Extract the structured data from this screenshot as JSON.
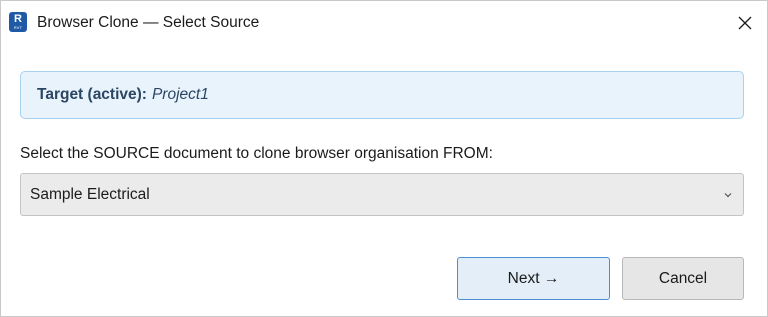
{
  "window": {
    "title": "Browser Clone — Select Source",
    "app_icon": {
      "name": "revit-icon",
      "letter": "R",
      "sub": "RVT",
      "color": "#1f5aa6"
    },
    "close_icon": "close-icon"
  },
  "target": {
    "label": "Target (active):",
    "value": "Project1"
  },
  "source": {
    "prompt": "Select the SOURCE document to clone browser organisation FROM:",
    "selected": "Sample Electrical"
  },
  "buttons": {
    "next_label": "Next →",
    "cancel_label": "Cancel"
  },
  "colors": {
    "info_bg": "#e8f3fc",
    "info_border": "#a9d1f0",
    "accent_border": "#4a8fd6"
  }
}
